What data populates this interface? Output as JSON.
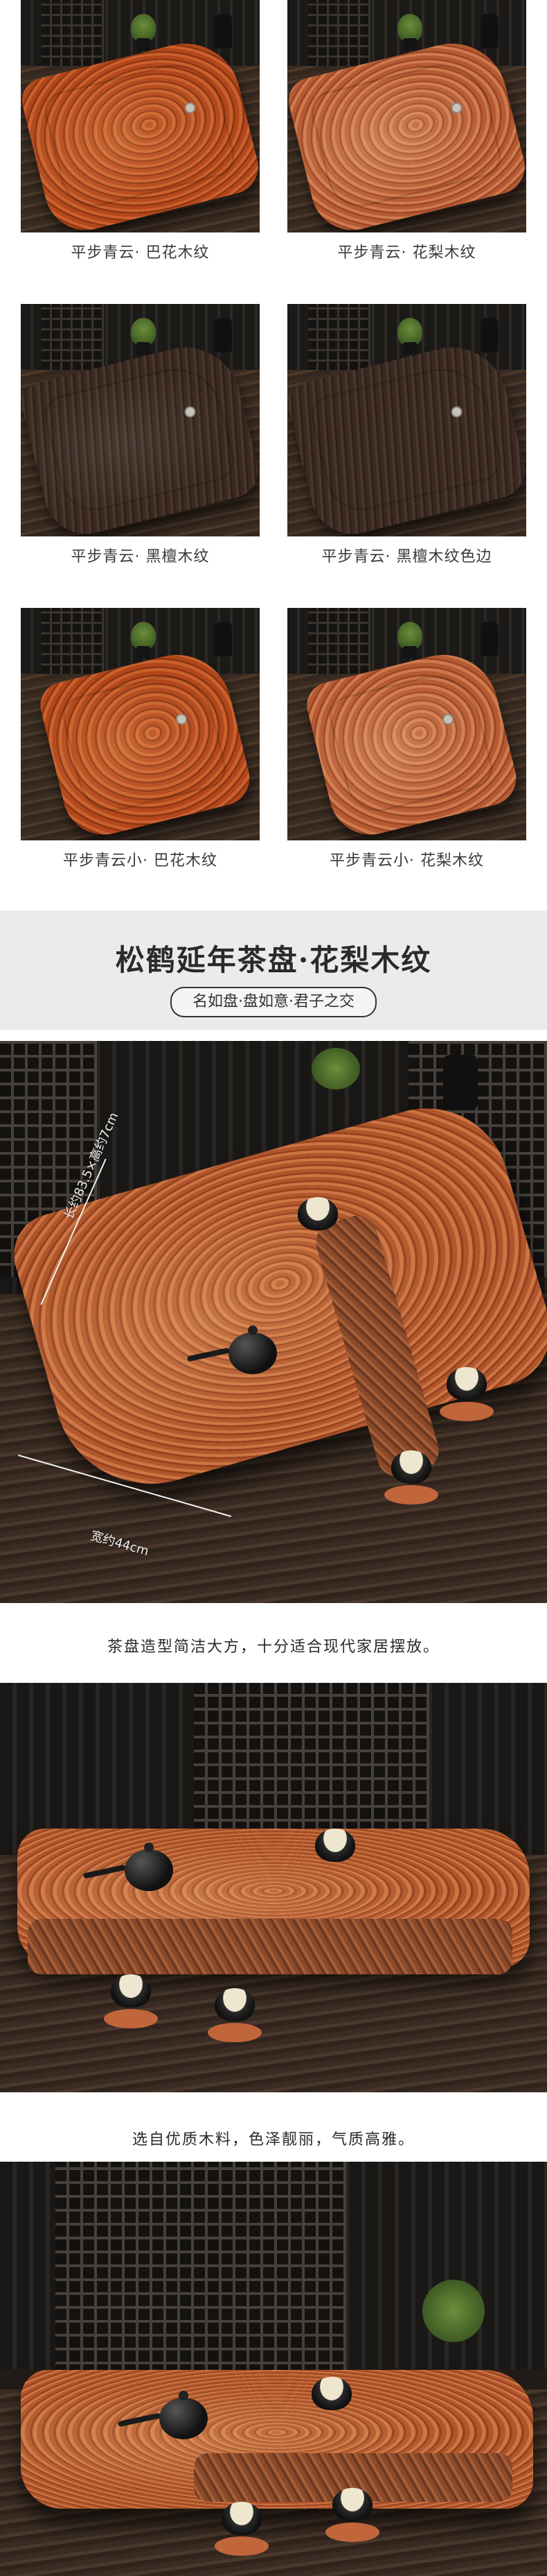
{
  "products": [
    {
      "caption": "平步青云· 巴花木纹",
      "finish": "ba"
    },
    {
      "caption": "平步青云· 花梨木纹",
      "finish": "hl"
    },
    {
      "caption": "平步青云· 黑檀木纹",
      "finish": "hd"
    },
    {
      "caption": "平步青云· 黑檀木纹色边",
      "finish": "hd-edge"
    },
    {
      "caption": "平步青云小· 巴花木纹",
      "finish": "ba"
    },
    {
      "caption": "平步青云小· 花梨木纹",
      "finish": "hl"
    }
  ],
  "banner": {
    "title": "松鹤延年茶盘·花梨木纹",
    "tagline": "名如盘·盘如意·君子之交"
  },
  "feature1": {
    "length_label": "长约83.5×高约7cm",
    "width_label": "宽约44cm",
    "text": "茶盘造型简洁大方，十分适合现代家居摆放。"
  },
  "feature2": {
    "text": "选自优质木料，色泽靓丽，气质高雅。"
  }
}
